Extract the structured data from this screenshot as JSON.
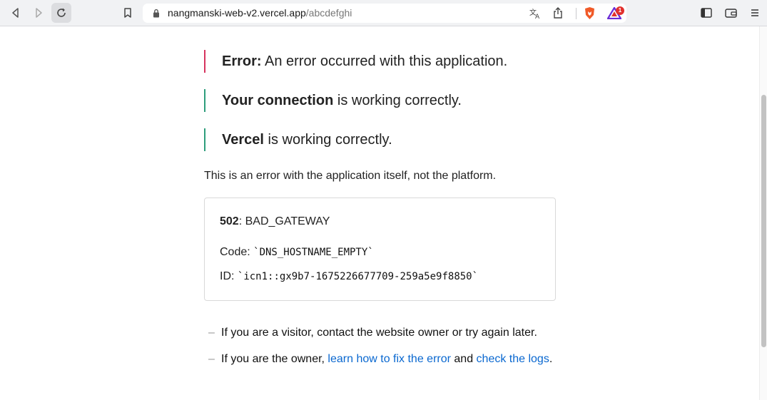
{
  "browser": {
    "url_host": "nangmanski-web-v2.vercel.app",
    "url_path": "/abcdefghi",
    "shield_badge_count": "1",
    "colors": {
      "toolbar": "#f1f2f4",
      "brave_orange": "#f05a28",
      "badge_red": "#e2302c"
    }
  },
  "status": [
    {
      "label": "Error:",
      "text": " An error occurred with this application.",
      "kind": "error"
    },
    {
      "label": "Your connection",
      "text": " is working correctly.",
      "kind": "ok"
    },
    {
      "label": "Vercel",
      "text": " is working correctly.",
      "kind": "ok"
    }
  ],
  "note": "This is an error with the application itself, not the platform.",
  "error_box": {
    "status_code": "502",
    "status_name": ": BAD_GATEWAY",
    "code_label": "Code: ",
    "code_value": "`DNS_HOSTNAME_EMPTY`",
    "id_label": "ID: ",
    "id_value": "`icn1::gx9b7-1675226677709-259a5e9f8850`"
  },
  "help": {
    "visitor": "If you are a visitor, contact the website owner or try again later.",
    "owner_prefix": "If you are the owner, ",
    "fix_link": "learn how to fix the error",
    "and": " and ",
    "logs_link": "check the logs",
    "period": "."
  },
  "icons": [
    "back-icon",
    "forward-icon",
    "reload-icon",
    "bookmark-icon",
    "lock-icon",
    "translate-icon",
    "share-icon",
    "brave-shield-icon",
    "brave-rewards-icon",
    "sidebar-icon",
    "wallet-icon",
    "menu-icon"
  ]
}
